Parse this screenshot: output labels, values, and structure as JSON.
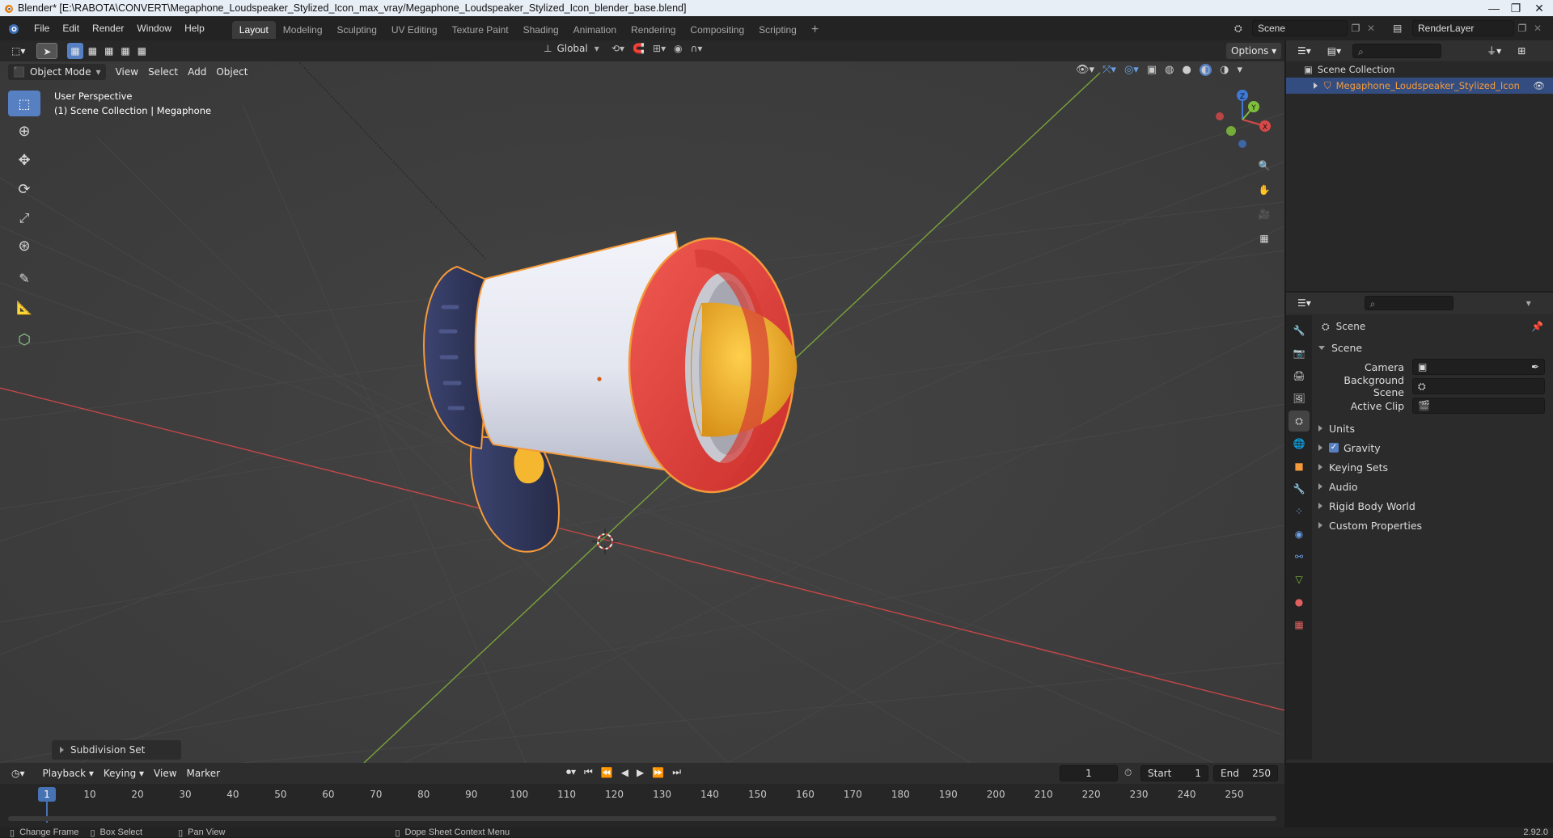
{
  "window": {
    "title": "Blender* [E:\\RABOTA\\CONVERT\\Megaphone_Loudspeaker_Stylized_Icon_max_vray/Megaphone_Loudspeaker_Stylized_Icon_blender_base.blend]"
  },
  "menu": [
    "File",
    "Edit",
    "Render",
    "Window",
    "Help"
  ],
  "workspaces": [
    "Layout",
    "Modeling",
    "Sculpting",
    "UV Editing",
    "Texture Paint",
    "Shading",
    "Animation",
    "Rendering",
    "Compositing",
    "Scripting"
  ],
  "active_workspace": "Layout",
  "scene_field": "Scene",
  "view_layer_field": "RenderLayer",
  "viewport": {
    "transform_orientation": "Global",
    "options_label": "Options",
    "mode": "Object Mode",
    "header_menu": [
      "View",
      "Select",
      "Add",
      "Object"
    ],
    "overlay_line1": "User Perspective",
    "overlay_line2": "(1) Scene Collection | Megaphone",
    "last_operator": "Subdivision Set",
    "gizmo_axes": {
      "x": "X",
      "y": "Y",
      "z": "Z"
    }
  },
  "outliner": {
    "root": "Scene Collection",
    "items": [
      {
        "label": "Megaphone_Loudspeaker_Stylized_Icon",
        "selected": true
      }
    ]
  },
  "properties": {
    "context_title": "Scene",
    "panel_title": "Scene",
    "fields": [
      {
        "label": "Camera",
        "value": ""
      },
      {
        "label": "Background Scene",
        "value": ""
      },
      {
        "label": "Active Clip",
        "value": ""
      }
    ],
    "sections": [
      {
        "label": "Units",
        "checkbox": false
      },
      {
        "label": "Gravity",
        "checkbox": true,
        "checked": true
      },
      {
        "label": "Keying Sets",
        "checkbox": false
      },
      {
        "label": "Audio",
        "checkbox": false
      },
      {
        "label": "Rigid Body World",
        "checkbox": false
      },
      {
        "label": "Custom Properties",
        "checkbox": false
      }
    ]
  },
  "timeline": {
    "menu": [
      "Playback",
      "Keying",
      "View",
      "Marker"
    ],
    "current_frame": "1",
    "start_label": "Start",
    "start": "1",
    "end_label": "End",
    "end": "250",
    "ruler_ticks": [
      "10",
      "20",
      "30",
      "40",
      "50",
      "60",
      "70",
      "80",
      "90",
      "100",
      "110",
      "120",
      "130",
      "140",
      "150",
      "160",
      "170",
      "180",
      "190",
      "200",
      "210",
      "220",
      "230",
      "240",
      "250"
    ],
    "playhead_label": "1"
  },
  "statusbar": {
    "items": [
      "Change Frame",
      "Box Select",
      "Pan View",
      "Dope Sheet Context Menu"
    ],
    "version": "2.92.0"
  },
  "colors": {
    "accent_blue": "#5680c2",
    "selection_orange": "#f59a3a",
    "megaphone_red": "#e8413c",
    "megaphone_yellow": "#f5b72f",
    "megaphone_navy": "#2f3557",
    "megaphone_white": "#eceef5",
    "axis_x_red": "#c64747",
    "axis_y_green": "#7aa33b"
  }
}
